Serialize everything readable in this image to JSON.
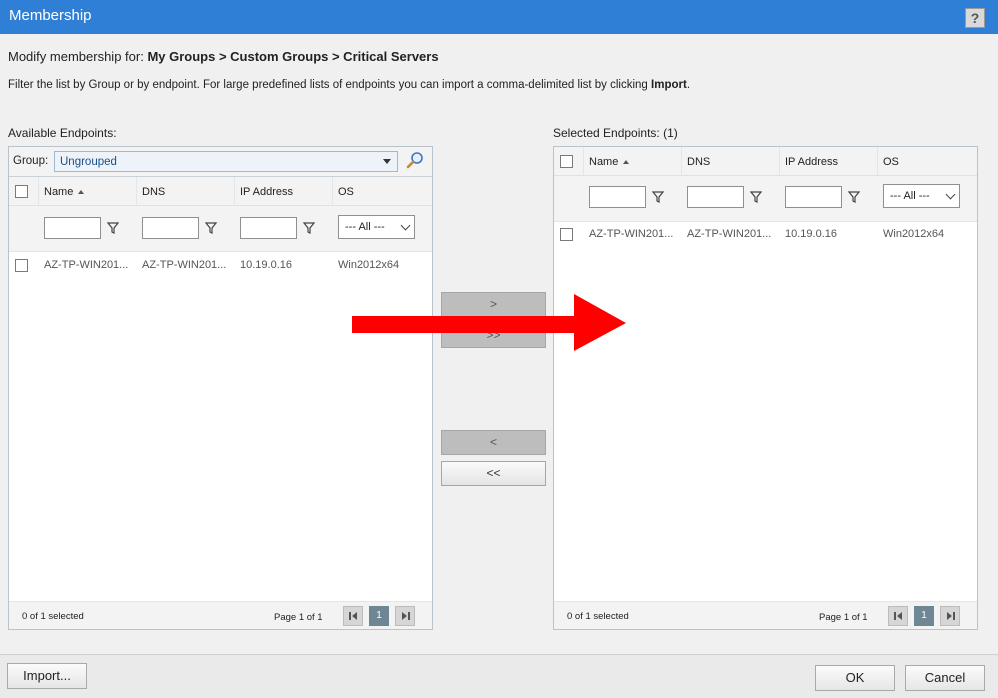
{
  "window": {
    "title": "Membership",
    "help_label": "?"
  },
  "modify": {
    "prefix": "Modify membership for: ",
    "path": "My Groups > Custom Groups > Critical Servers"
  },
  "instructions": {
    "text": "Filter the list by Group or by endpoint. For large predefined lists of endpoints you can import a comma-delimited list by clicking ",
    "bold": "Import",
    "suffix": "."
  },
  "available": {
    "label": "Available Endpoints:",
    "group_label": "Group:",
    "group_value": "Ungrouped",
    "columns": [
      "Name",
      "DNS",
      "IP Address",
      "OS"
    ],
    "os_filter": "--- All ---",
    "rows": [
      {
        "name": "AZ-TP-WIN201...",
        "dns": "AZ-TP-WIN201...",
        "ip": "10.19.0.16",
        "os": "Win2012x64"
      }
    ],
    "selection": "0 of 1 selected",
    "page_info": "Page 1 of 1",
    "page": "1"
  },
  "selected": {
    "label": "Selected Endpoints: (1)",
    "columns": [
      "Name",
      "DNS",
      "IP Address",
      "OS"
    ],
    "os_filter": "--- All ---",
    "rows": [
      {
        "name": "AZ-TP-WIN201...",
        "dns": "AZ-TP-WIN201...",
        "ip": "10.19.0.16",
        "os": "Win2012x64"
      }
    ],
    "selection": "0 of 1 selected",
    "page_info": "Page 1 of 1",
    "page": "1"
  },
  "move": {
    "add": ">",
    "add_all": ">>",
    "remove": "<",
    "remove_all": "<<"
  },
  "buttons": {
    "import": "Import...",
    "ok": "OK",
    "cancel": "Cancel"
  },
  "annotation": {
    "arrow_color": "#ff0000"
  }
}
